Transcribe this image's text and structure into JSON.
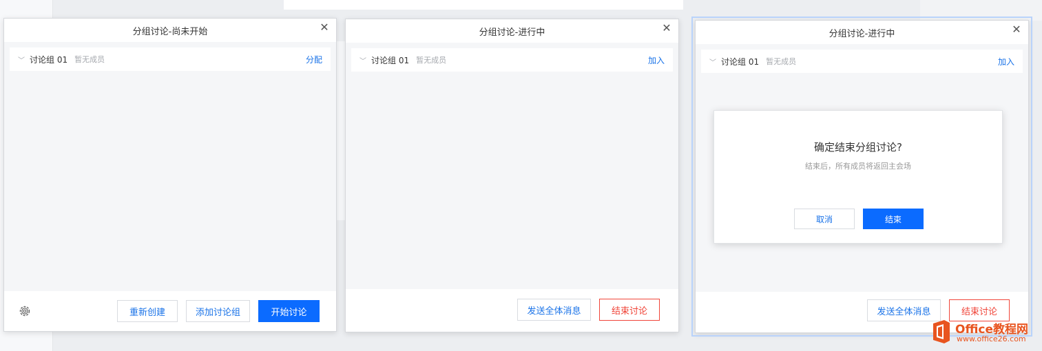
{
  "panels": [
    {
      "title": "分组讨论-尚未开始",
      "close_symbol": "✕",
      "group": {
        "name": "讨论组 01",
        "status": "暂无成员",
        "action": "分配"
      },
      "footer": {
        "recreate": "重新创建",
        "add_group": "添加讨论组",
        "start": "开始讨论"
      }
    },
    {
      "title": "分组讨论-进行中",
      "close_symbol": "✕",
      "group": {
        "name": "讨论组 01",
        "status": "暂无成员",
        "action": "加入"
      },
      "footer": {
        "broadcast": "发送全体消息",
        "end": "结束讨论"
      }
    },
    {
      "title": "分组讨论-进行中",
      "close_symbol": "✕",
      "group": {
        "name": "讨论组 01",
        "status": "暂无成员",
        "action": "加入"
      },
      "footer": {
        "broadcast": "发送全体消息",
        "end": "结束讨论"
      },
      "dialog": {
        "title": "确定结束分组讨论?",
        "message": "结束后，所有成员将返回主会场",
        "cancel": "取消",
        "confirm": "结束"
      }
    }
  ],
  "icons": {
    "chevron": "chevron-down-icon",
    "close": "close-icon",
    "settings": "gear-icon"
  },
  "watermark": {
    "title": "Office教程网",
    "url": "www.office26.com"
  },
  "colors": {
    "primary": "#0b6bff",
    "danger": "#f04438",
    "link": "#1a73e8",
    "body_bg": "#f5f6f8",
    "watermark": "#e8541f"
  }
}
